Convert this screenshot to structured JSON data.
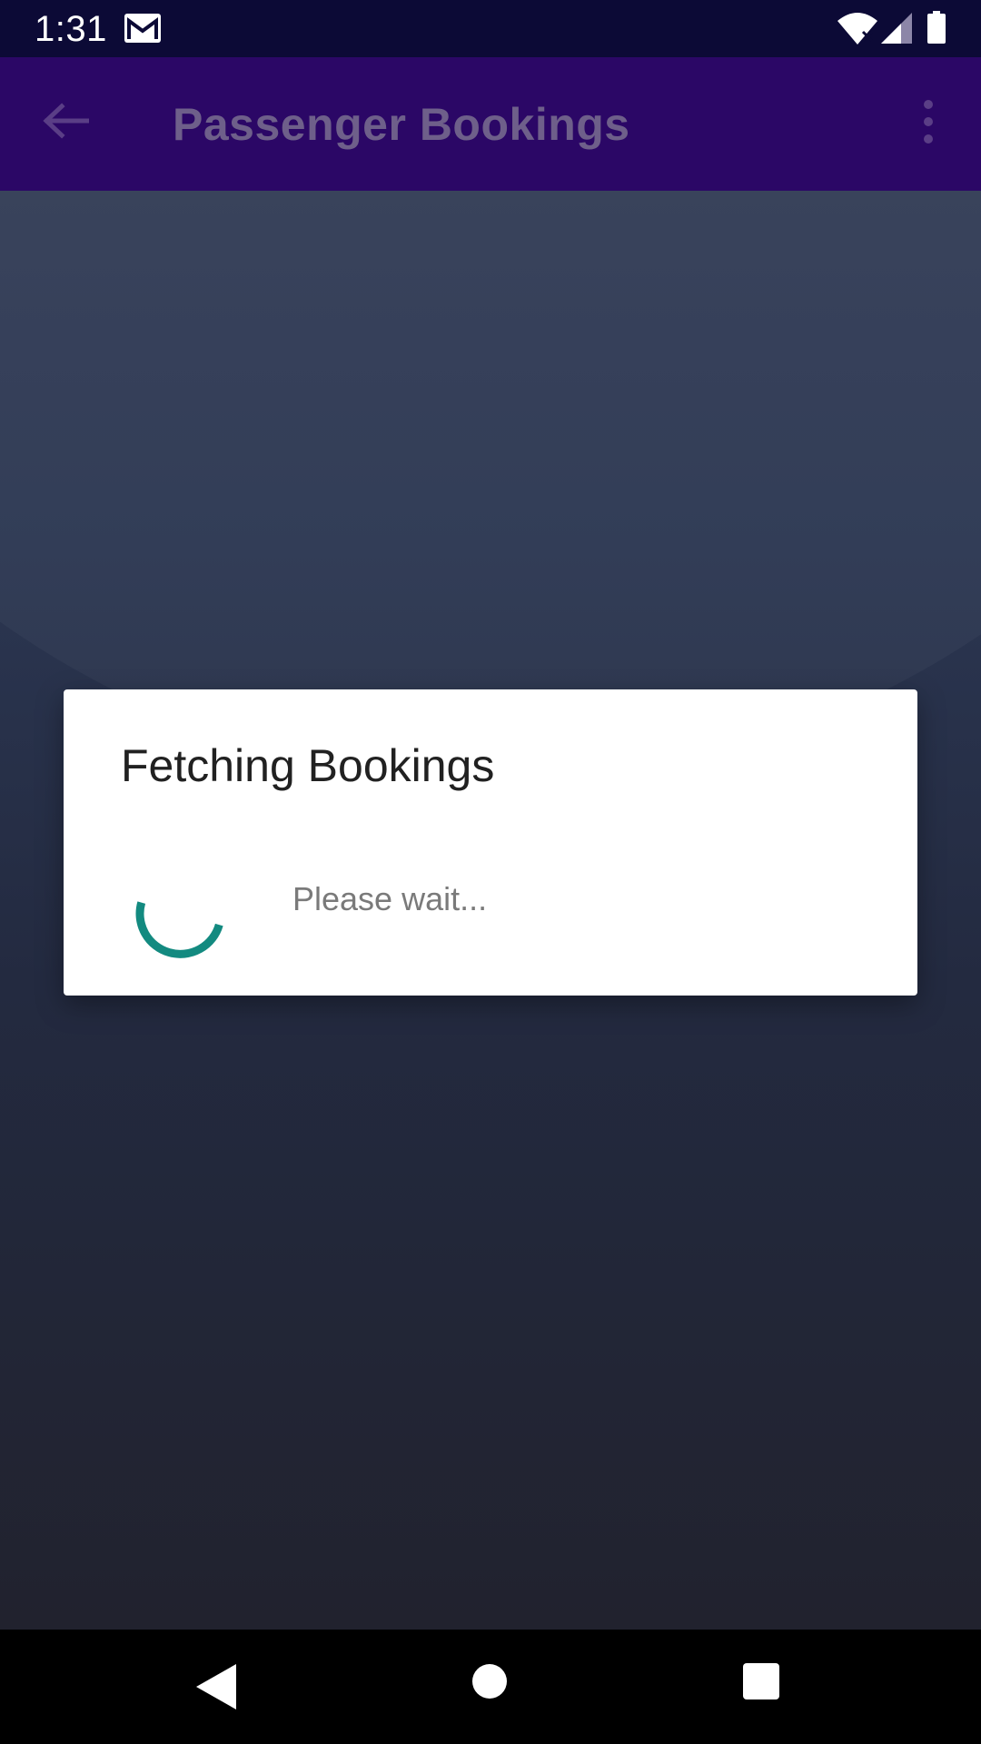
{
  "status_bar": {
    "time": "1:31",
    "icons": [
      "gmail-icon",
      "wifi-icon",
      "cell-signal-icon",
      "battery-icon"
    ]
  },
  "app_bar": {
    "title": "Passenger Bookings",
    "back_icon": "arrow-back-icon",
    "menu_icon": "overflow-menu-icon"
  },
  "dialog": {
    "title": "Fetching Bookings",
    "message": "Please wait...",
    "spinner_color": "#138a80"
  },
  "nav_bar": {
    "icons": [
      "nav-back-icon",
      "nav-home-icon",
      "nav-recents-icon"
    ]
  },
  "colors": {
    "status_bar": "#0c0a36",
    "app_bar": "#2b0766",
    "app_title": "#6e5f8a",
    "dialog_background": "#ffffff",
    "accent": "#138a80"
  }
}
